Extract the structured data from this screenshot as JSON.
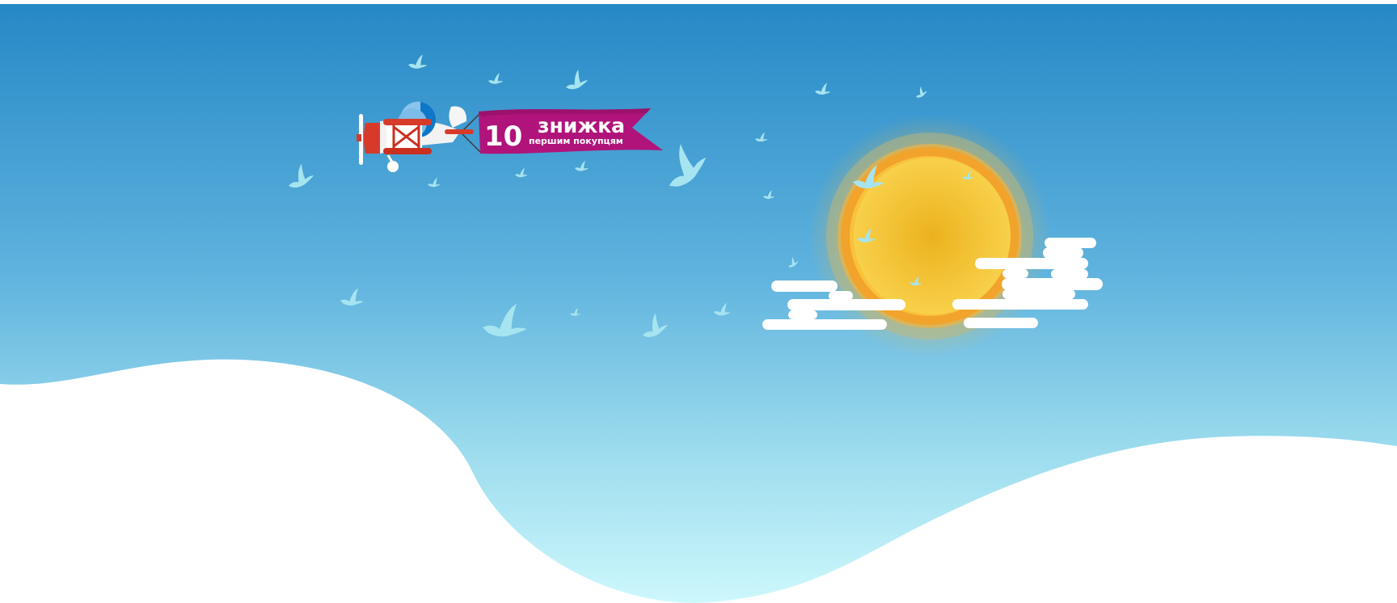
{
  "banner": {
    "number": "10",
    "title": "знижка",
    "subtitle": "першим покупцям"
  },
  "colors": {
    "sky_top": "#2a8cc8",
    "sky_bottom": "#c8f6fb",
    "banner": "#b0147a",
    "plane_body": "#d83a2a",
    "sun": "#f5c232",
    "sun_halo": "#f0a030",
    "cloud": "#ffffff",
    "bird": "#a8e6f0"
  },
  "icons": [
    "biplane-icon",
    "bird-icon",
    "sun-icon",
    "cloud-icon"
  ]
}
